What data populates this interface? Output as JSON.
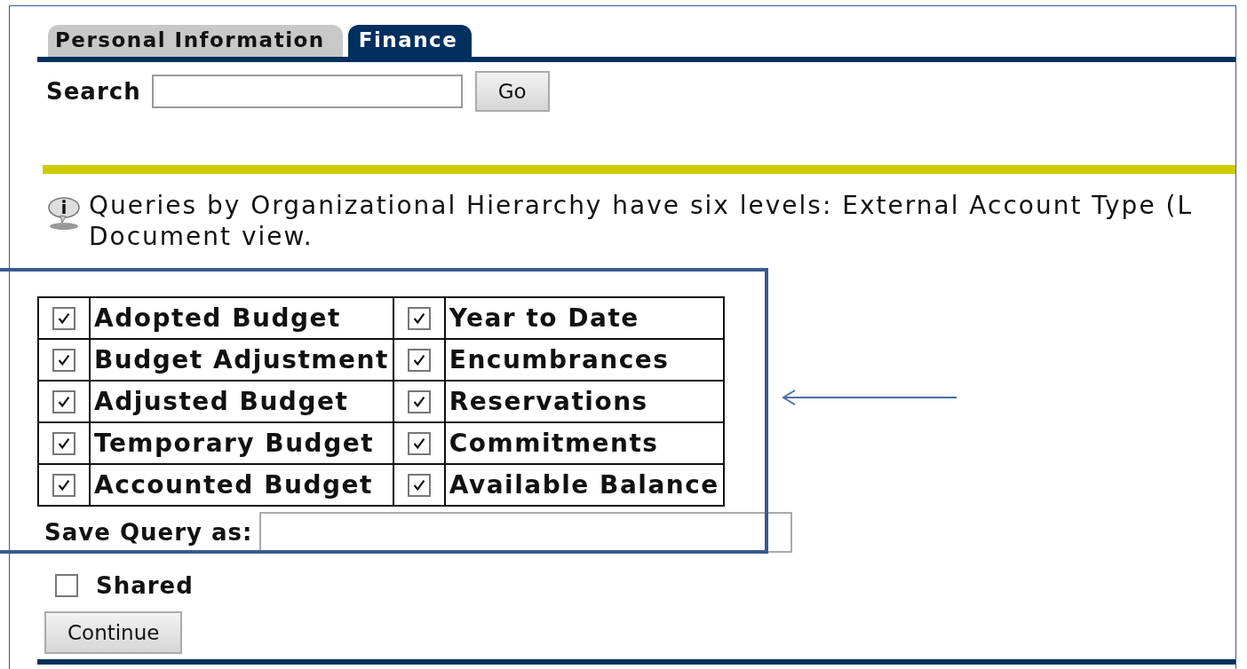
{
  "tabs": [
    {
      "label": "Personal Information",
      "selected": false
    },
    {
      "label": "Finance",
      "selected": true
    }
  ],
  "search": {
    "label": "Search",
    "button": "Go"
  },
  "info": {
    "text": "Queries by Organizational Hierarchy have six levels: External Account Type (L\nDocument view."
  },
  "options": [
    [
      {
        "label": "Adopted Budget",
        "checked": true
      },
      {
        "label": "Year to Date",
        "checked": true
      }
    ],
    [
      {
        "label": "Budget Adjustment",
        "checked": true
      },
      {
        "label": "Encumbrances",
        "checked": true
      }
    ],
    [
      {
        "label": "Adjusted Budget",
        "checked": true
      },
      {
        "label": "Reservations",
        "checked": true
      }
    ],
    [
      {
        "label": "Temporary Budget",
        "checked": true
      },
      {
        "label": "Commitments",
        "checked": true
      }
    ],
    [
      {
        "label": "Accounted Budget",
        "checked": true
      },
      {
        "label": "Available Balance",
        "checked": true
      }
    ]
  ],
  "save_query": {
    "label": "Save Query as:"
  },
  "shared": {
    "label": "Shared",
    "checked": false
  },
  "continue_button": "Continue"
}
